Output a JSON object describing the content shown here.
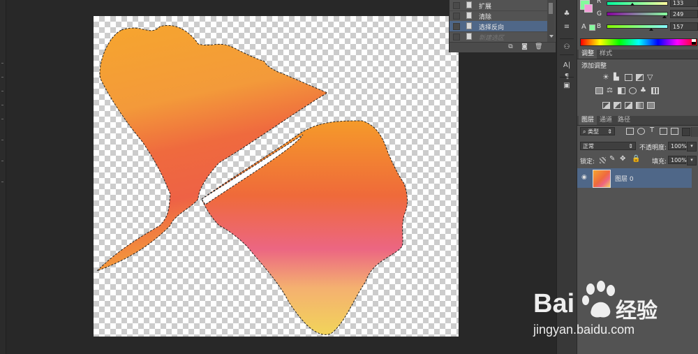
{
  "history": {
    "items": [
      {
        "label": "扩展"
      },
      {
        "label": "清除"
      },
      {
        "label": "选择反向"
      },
      {
        "label": "新建选区"
      }
    ]
  },
  "color": {
    "r_label": "R",
    "r_value": "133",
    "g_label": "G",
    "g_value": "249",
    "b_label": "B",
    "b_value": "157",
    "foreground": "#85f99d"
  },
  "adjust": {
    "tabs": [
      "调整",
      "样式"
    ],
    "title": "添加调整"
  },
  "layers": {
    "tabs": [
      "图层",
      "通道",
      "路径"
    ],
    "filter_label": "类型",
    "blend_mode": "正常",
    "opacity_label": "不透明度:",
    "opacity_value": "100%",
    "lock_label": "锁定:",
    "fill_label": "填充:",
    "fill_value": "100%",
    "layer_name": "图层 0"
  },
  "watermark": {
    "brand": "Bai",
    "brand_suffix": "经验",
    "url": "jingyan.baidu.com"
  }
}
